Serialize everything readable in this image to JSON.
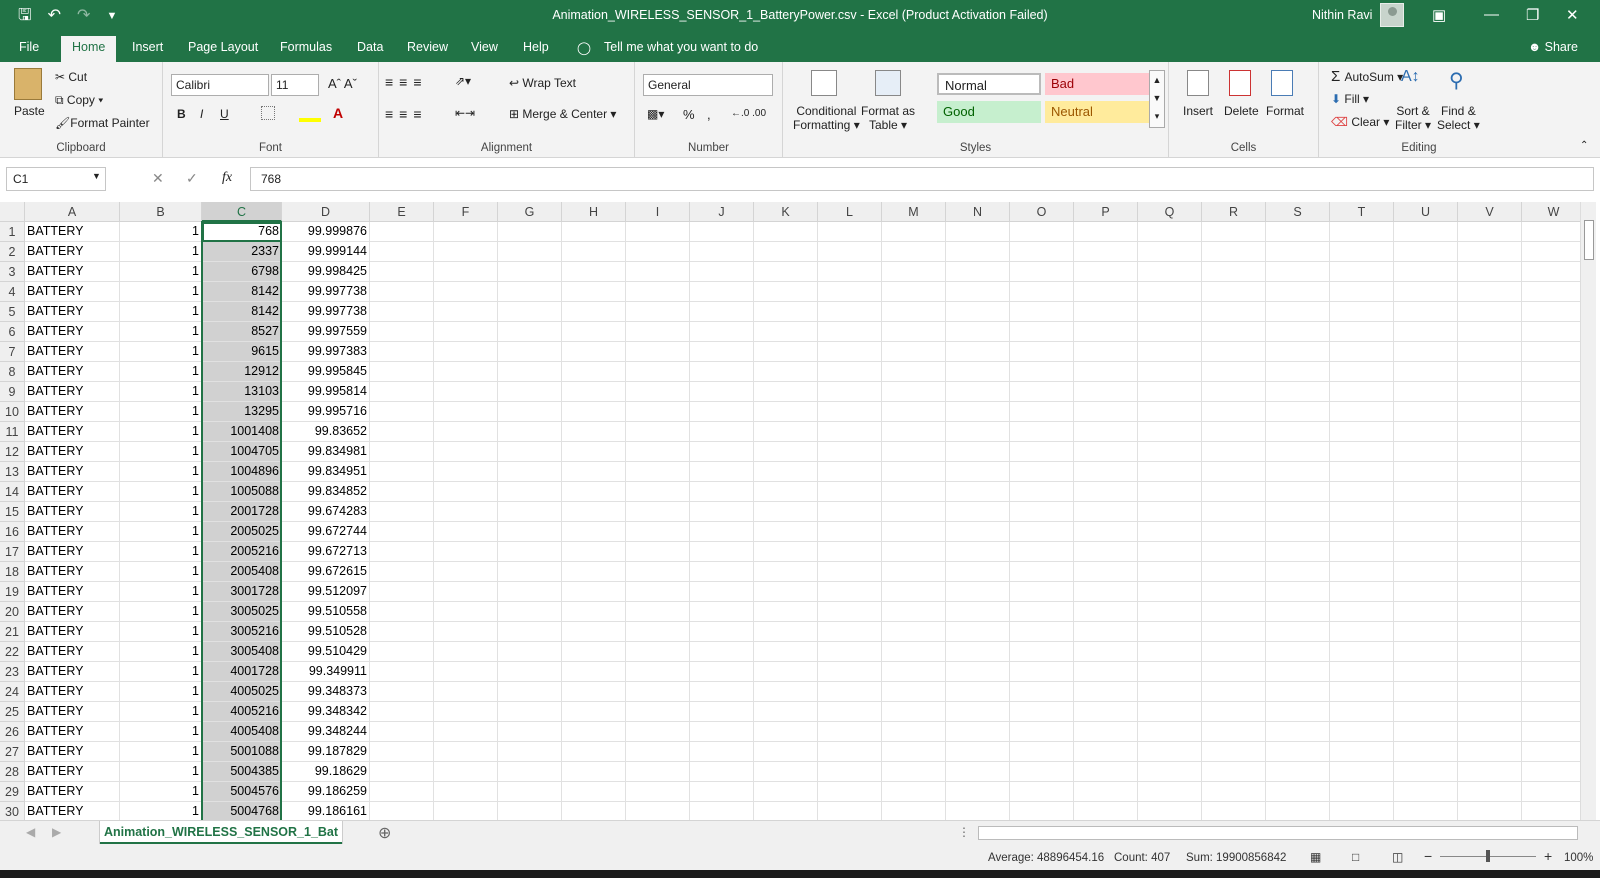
{
  "window": {
    "title": "Animation_WIRELESS_SENSOR_1_BatteryPower.csv  -  Excel (Product Activation Failed)",
    "user": "Nithin Ravi"
  },
  "qat": {
    "save_icon": "save-icon",
    "undo_icon": "undo-icon",
    "redo_icon": "redo-icon",
    "customize_icon": "customize-qat-icon"
  },
  "menu": {
    "file": "File",
    "home": "Home",
    "insert": "Insert",
    "page_layout": "Page Layout",
    "formulas": "Formulas",
    "data": "Data",
    "review": "Review",
    "view": "View",
    "help": "Help",
    "tell_me": "Tell me what you want to do",
    "share": "Share"
  },
  "ribbon": {
    "clipboard": {
      "paste": "Paste",
      "cut": "Cut",
      "copy": "Copy",
      "format_painter": "Format Painter",
      "label": "Clipboard"
    },
    "font": {
      "name": "Calibri",
      "size": "11",
      "bold": "B",
      "italic": "I",
      "underline": "U",
      "label": "Font"
    },
    "alignment": {
      "wrap_text": "Wrap Text",
      "merge_center": "Merge & Center",
      "label": "Alignment"
    },
    "number": {
      "format": "General",
      "percent": "%",
      "comma": ",",
      "label": "Number"
    },
    "styles": {
      "conditional": "Conditional",
      "formatting": "Formatting",
      "format_as": "Format as",
      "table": "Table",
      "normal": "Normal",
      "bad": "Bad",
      "good": "Good",
      "neutral": "Neutral",
      "label": "Styles",
      "colors": {
        "bad_bg": "#ffc7ce",
        "bad_fg": "#9c0006",
        "good_bg": "#c6efce",
        "good_fg": "#006100",
        "neutral_bg": "#ffeb9c",
        "neutral_fg": "#9c5700"
      }
    },
    "cells": {
      "insert": "Insert",
      "delete": "Delete",
      "format": "Format",
      "label": "Cells"
    },
    "editing": {
      "autosum": "AutoSum",
      "fill": "Fill",
      "clear": "Clear",
      "sort1": "Sort &",
      "sort2": "Filter",
      "find1": "Find &",
      "find2": "Select",
      "label": "Editing"
    }
  },
  "formula_bar": {
    "name_box": "C1",
    "fx": "fx",
    "value": "768"
  },
  "columns": [
    "A",
    "B",
    "C",
    "D",
    "E",
    "F",
    "G",
    "H",
    "I",
    "J",
    "K",
    "L",
    "M",
    "N",
    "O",
    "P",
    "Q",
    "R",
    "S",
    "T",
    "U",
    "V",
    "W"
  ],
  "rows": [
    {
      "n": "1",
      "a": "BATTERY",
      "b": "1",
      "c": "768",
      "d": "99.999876"
    },
    {
      "n": "2",
      "a": "BATTERY",
      "b": "1",
      "c": "2337",
      "d": "99.999144"
    },
    {
      "n": "3",
      "a": "BATTERY",
      "b": "1",
      "c": "6798",
      "d": "99.998425"
    },
    {
      "n": "4",
      "a": "BATTERY",
      "b": "1",
      "c": "8142",
      "d": "99.997738"
    },
    {
      "n": "5",
      "a": "BATTERY",
      "b": "1",
      "c": "8142",
      "d": "99.997738"
    },
    {
      "n": "6",
      "a": "BATTERY",
      "b": "1",
      "c": "8527",
      "d": "99.997559"
    },
    {
      "n": "7",
      "a": "BATTERY",
      "b": "1",
      "c": "9615",
      "d": "99.997383"
    },
    {
      "n": "8",
      "a": "BATTERY",
      "b": "1",
      "c": "12912",
      "d": "99.995845"
    },
    {
      "n": "9",
      "a": "BATTERY",
      "b": "1",
      "c": "13103",
      "d": "99.995814"
    },
    {
      "n": "10",
      "a": "BATTERY",
      "b": "1",
      "c": "13295",
      "d": "99.995716"
    },
    {
      "n": "11",
      "a": "BATTERY",
      "b": "1",
      "c": "1001408",
      "d": "99.83652"
    },
    {
      "n": "12",
      "a": "BATTERY",
      "b": "1",
      "c": "1004705",
      "d": "99.834981"
    },
    {
      "n": "13",
      "a": "BATTERY",
      "b": "1",
      "c": "1004896",
      "d": "99.834951"
    },
    {
      "n": "14",
      "a": "BATTERY",
      "b": "1",
      "c": "1005088",
      "d": "99.834852"
    },
    {
      "n": "15",
      "a": "BATTERY",
      "b": "1",
      "c": "2001728",
      "d": "99.674283"
    },
    {
      "n": "16",
      "a": "BATTERY",
      "b": "1",
      "c": "2005025",
      "d": "99.672744"
    },
    {
      "n": "17",
      "a": "BATTERY",
      "b": "1",
      "c": "2005216",
      "d": "99.672713"
    },
    {
      "n": "18",
      "a": "BATTERY",
      "b": "1",
      "c": "2005408",
      "d": "99.672615"
    },
    {
      "n": "19",
      "a": "BATTERY",
      "b": "1",
      "c": "3001728",
      "d": "99.512097"
    },
    {
      "n": "20",
      "a": "BATTERY",
      "b": "1",
      "c": "3005025",
      "d": "99.510558"
    },
    {
      "n": "21",
      "a": "BATTERY",
      "b": "1",
      "c": "3005216",
      "d": "99.510528"
    },
    {
      "n": "22",
      "a": "BATTERY",
      "b": "1",
      "c": "3005408",
      "d": "99.510429"
    },
    {
      "n": "23",
      "a": "BATTERY",
      "b": "1",
      "c": "4001728",
      "d": "99.349911"
    },
    {
      "n": "24",
      "a": "BATTERY",
      "b": "1",
      "c": "4005025",
      "d": "99.348373"
    },
    {
      "n": "25",
      "a": "BATTERY",
      "b": "1",
      "c": "4005216",
      "d": "99.348342"
    },
    {
      "n": "26",
      "a": "BATTERY",
      "b": "1",
      "c": "4005408",
      "d": "99.348244"
    },
    {
      "n": "27",
      "a": "BATTERY",
      "b": "1",
      "c": "5001088",
      "d": "99.187829"
    },
    {
      "n": "28",
      "a": "BATTERY",
      "b": "1",
      "c": "5004385",
      "d": "99.18629"
    },
    {
      "n": "29",
      "a": "BATTERY",
      "b": "1",
      "c": "5004576",
      "d": "99.186259"
    },
    {
      "n": "30",
      "a": "BATTERY",
      "b": "1",
      "c": "5004768",
      "d": "99.186161"
    }
  ],
  "selected_column": "C",
  "sheet": {
    "tab": "Animation_WIRELESS_SENSOR_1_Bat",
    "add": "⊕"
  },
  "status": {
    "average": "Average: 48896454.16",
    "count": "Count: 407",
    "sum": "Sum: 19900856842",
    "zoom": "100%"
  }
}
